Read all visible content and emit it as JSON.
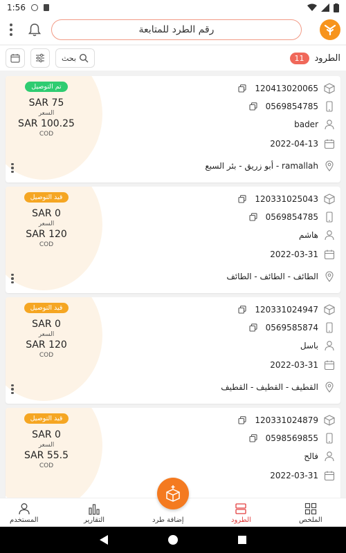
{
  "status_bar": {
    "time": "1:56"
  },
  "header": {
    "search_placeholder": "رقم الطرد للمتابعة",
    "brand_color": "#f7941d"
  },
  "toolbar": {
    "search_label": "بحث",
    "parcels_label": "الطرود",
    "parcels_count": "11"
  },
  "parcels": [
    {
      "status": "تم التوصيل",
      "status_color": "#2ecc71",
      "price": "SAR 75",
      "price_label": "السعر",
      "cod": "SAR 100.25",
      "cod_label": "COD",
      "tracking": "120413020065",
      "phone": "0569854785",
      "name": "bader",
      "date": "2022-04-13",
      "address": "أبو زريق - بئر السبع - ramallah"
    },
    {
      "status": "قيد التوصيل",
      "status_color": "#f5a623",
      "price": "SAR 0",
      "price_label": "السعر",
      "cod": "SAR 120",
      "cod_label": "COD",
      "tracking": "120331025043",
      "phone": "0569854785",
      "name": "هاشم",
      "date": "2022-03-31",
      "address": "الطائف - الطائف - الطائف"
    },
    {
      "status": "قيد التوصيل",
      "status_color": "#f5a623",
      "price": "SAR 0",
      "price_label": "السعر",
      "cod": "SAR 120",
      "cod_label": "COD",
      "tracking": "120331024947",
      "phone": "0569585874",
      "name": "باسل",
      "date": "2022-03-31",
      "address": "القطيف - القطيف - القطيف"
    },
    {
      "status": "قيد التوصيل",
      "status_color": "#f5a623",
      "price": "SAR 0",
      "price_label": "السعر",
      "cod": "SAR 55.5",
      "cod_label": "COD",
      "tracking": "120331024879",
      "phone": "0598569855",
      "name": "فالح",
      "date": "2022-03-31",
      "address": ""
    }
  ],
  "bottom_nav": {
    "summary": "الملخص",
    "parcels": "الطرود",
    "add_parcel": "إضافة طرد",
    "reports": "التقارير",
    "user": "المستخدم",
    "active_color": "#e33e3e"
  }
}
